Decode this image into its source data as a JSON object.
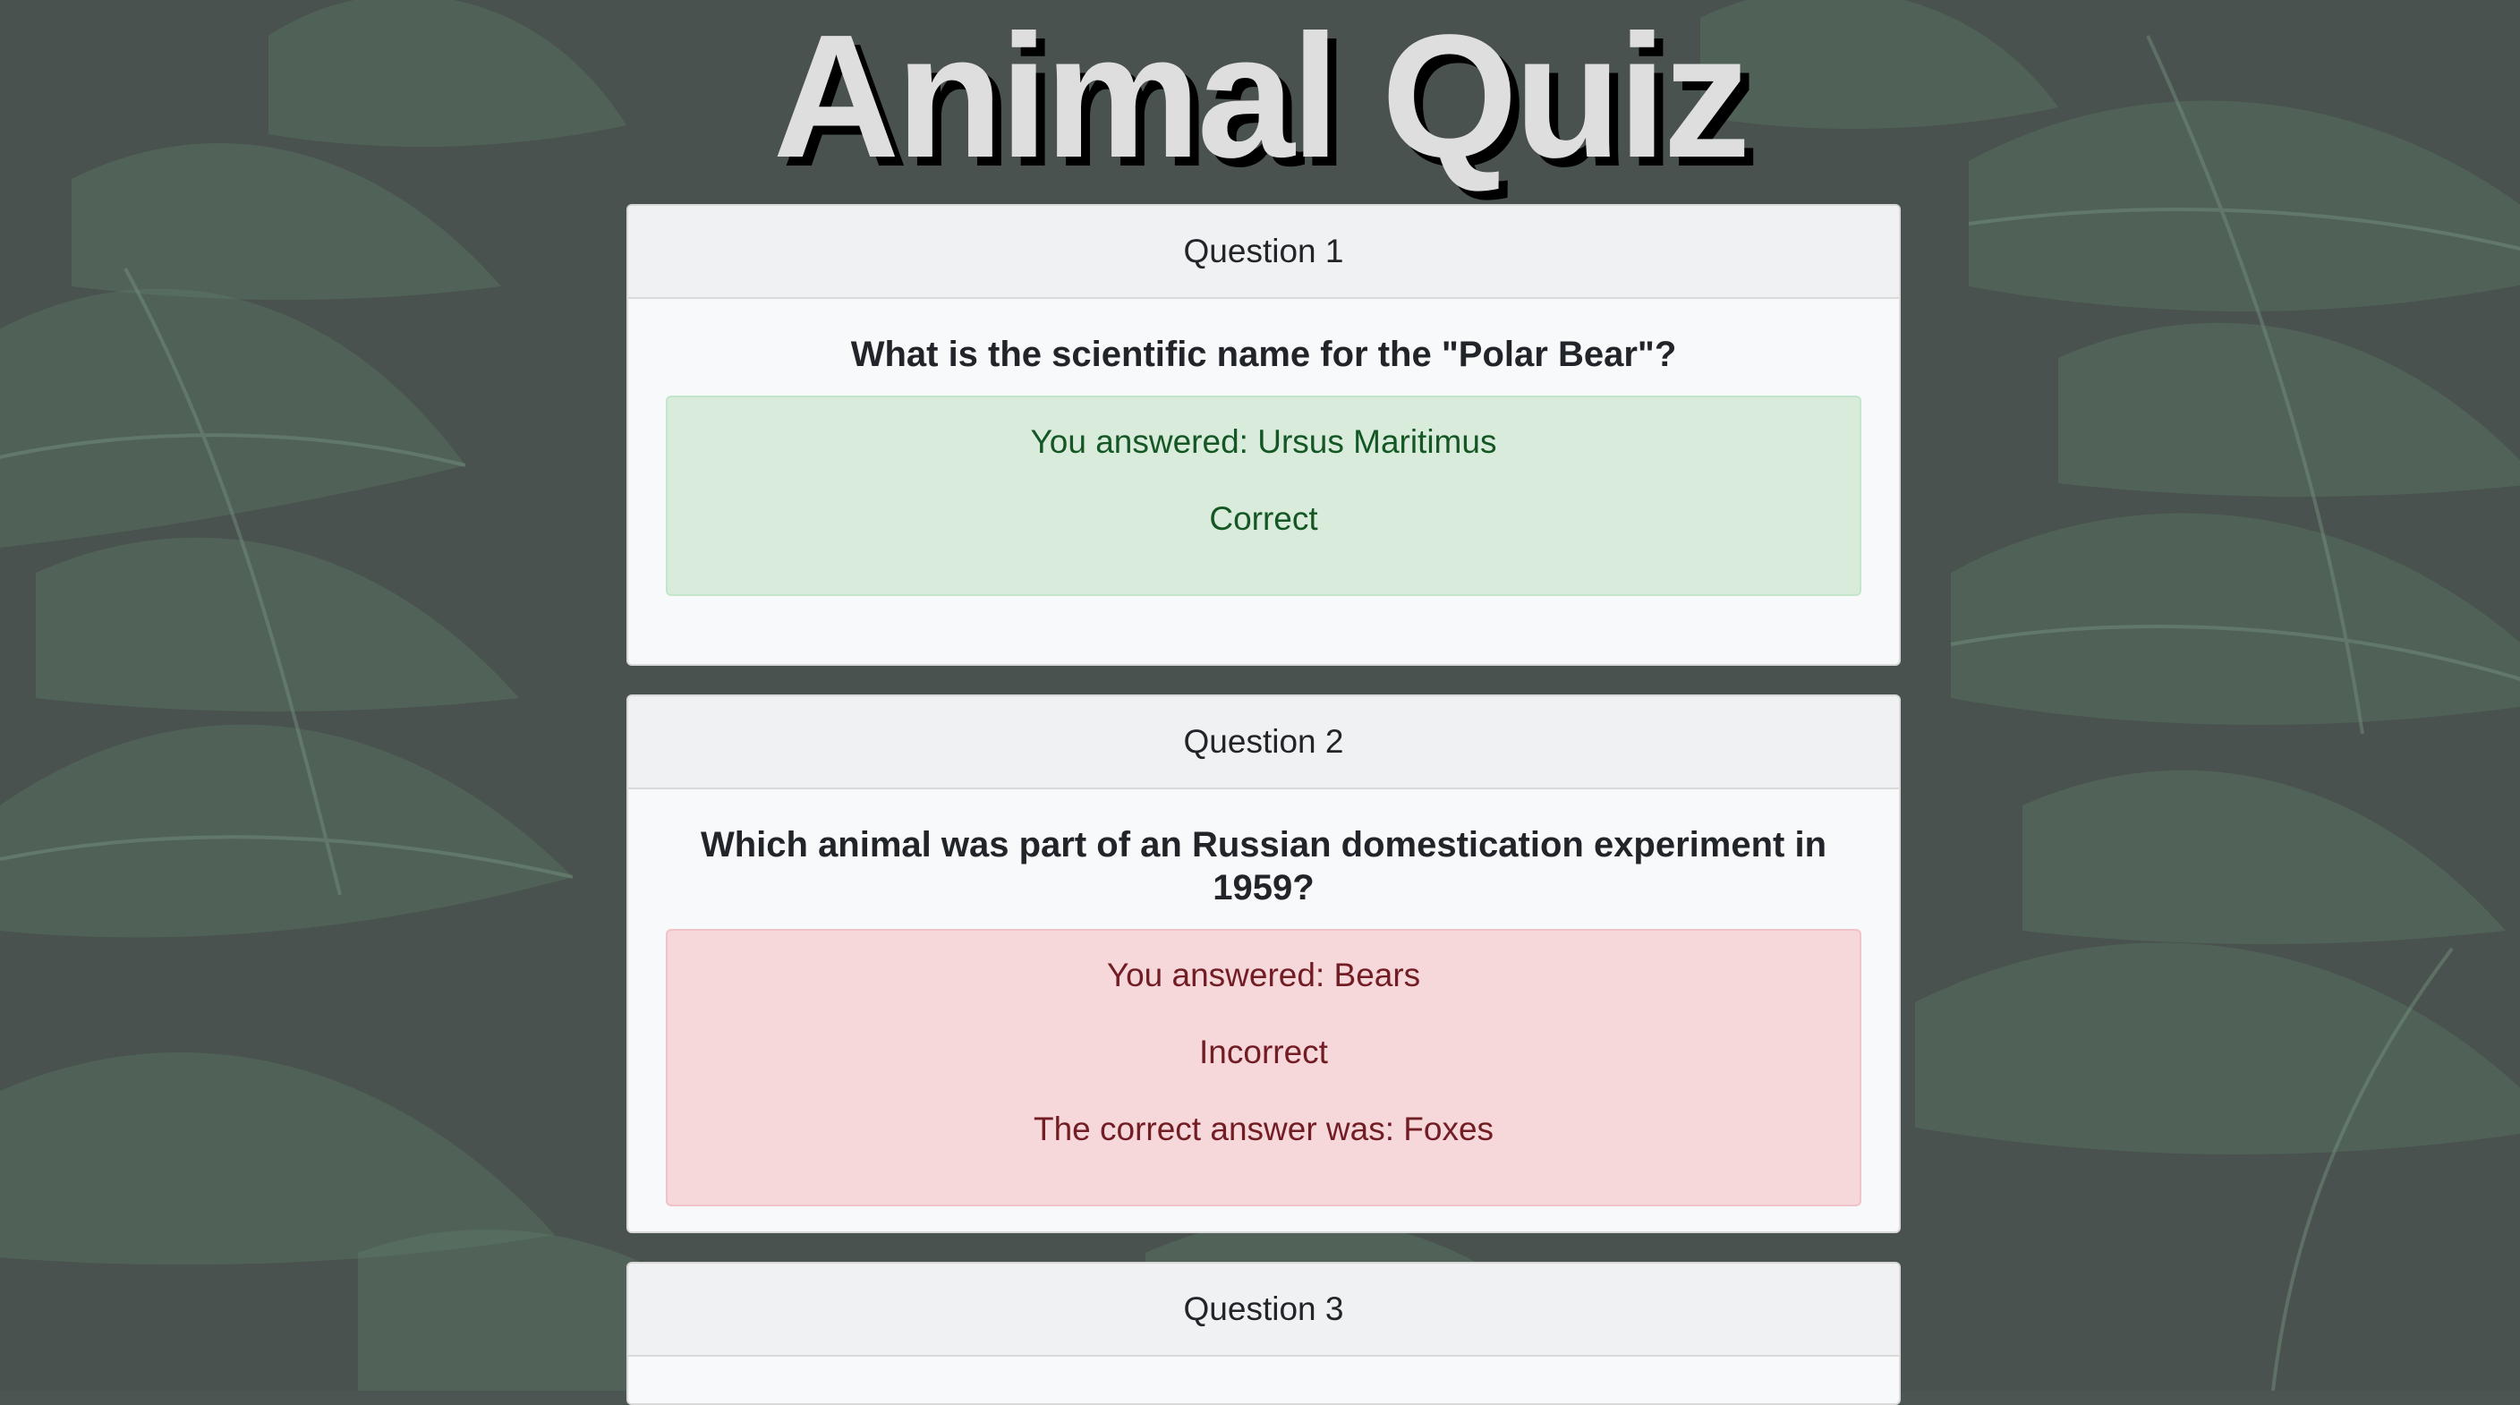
{
  "page": {
    "title": "Animal Quiz"
  },
  "questions": [
    {
      "header": "Question 1",
      "text": "What is the scientific name for the \"Polar Bear\"?",
      "result": "correct",
      "lines": [
        "You answered: Ursus Maritimus",
        "Correct"
      ]
    },
    {
      "header": "Question 2",
      "text": "Which animal was part of an Russian domestication experiment in 1959?",
      "result": "incorrect",
      "lines": [
        "You answered: Bears",
        "Incorrect",
        "The correct answer was: Foxes"
      ]
    },
    {
      "header": "Question 3"
    }
  ],
  "colors": {
    "correct_bg": "#d9ecdc",
    "correct_text": "#155724",
    "incorrect_bg": "#f6d7da",
    "incorrect_text": "#721c24",
    "title_text": "#dedede"
  }
}
